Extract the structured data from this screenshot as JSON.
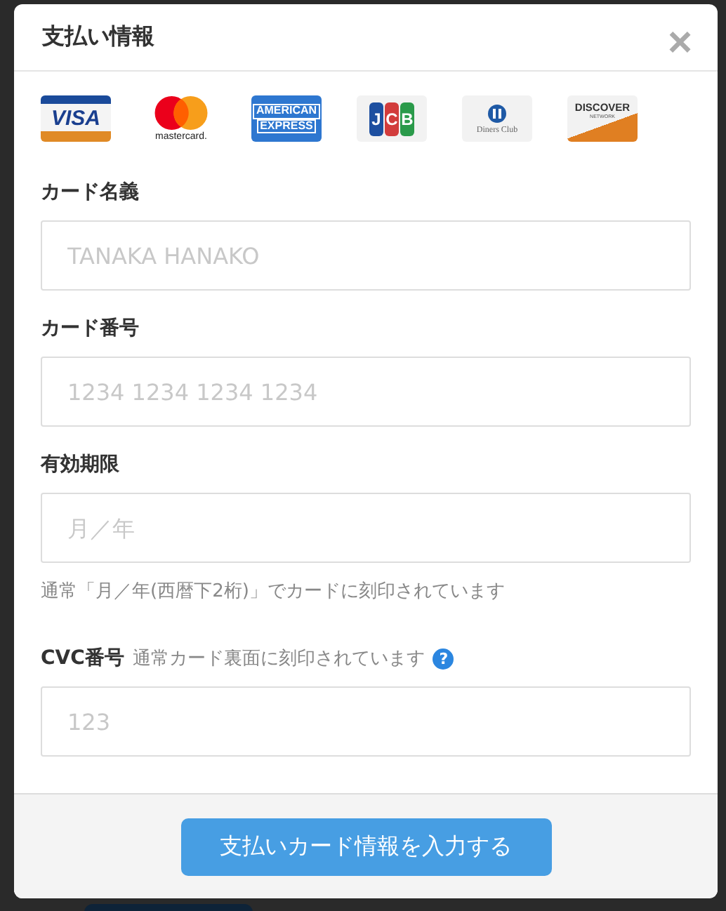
{
  "dialog": {
    "title": "支払い情報",
    "close": "×"
  },
  "cards": [
    {
      "kind": "visa",
      "lines": [
        "VISA"
      ]
    },
    {
      "kind": "mastercard",
      "lines": [
        "mastercard."
      ]
    },
    {
      "kind": "amex",
      "lines": [
        "AMERICAN",
        "EXPRESS"
      ]
    },
    {
      "kind": "jcb",
      "lines": [
        "J",
        "C",
        "B"
      ]
    },
    {
      "kind": "diners",
      "lines": [
        "Diners Club"
      ]
    },
    {
      "kind": "discover",
      "lines": [
        "DISCOVER",
        "NETWORK"
      ]
    }
  ],
  "fields": [
    {
      "label": "カード名義",
      "placeholder": "TANAKA HANAKO"
    },
    {
      "label": "カード番号",
      "placeholder": "1234 1234 1234 1234"
    },
    {
      "label": "有効期限",
      "placeholder": "月／年",
      "hint": "通常「月／年(西暦下2桁)」でカードに刻印されています"
    },
    {
      "label": "CVC番号",
      "note": "通常カード裏面に刻印されています",
      "help": "?",
      "placeholder": "123"
    }
  ],
  "submit": "支払いカード情報を入力する"
}
